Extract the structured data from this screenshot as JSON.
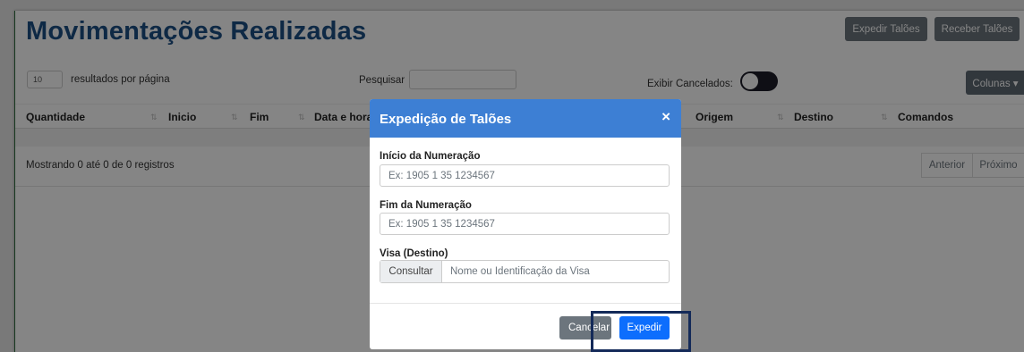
{
  "page": {
    "title": "Movimentações Realizadas",
    "buttons": {
      "expedir": "Expedir Talões",
      "receber": "Receber Talões"
    },
    "page_length": "10",
    "page_length_label": "resultados por página",
    "search_label": "Pesquisar",
    "search_value": "",
    "show_cancelled_label": "Exibir Cancelados:",
    "columns_button": "Colunas ▾",
    "table": {
      "headers": [
        "Quantidade",
        "Inicio",
        "Fim",
        "Data e hora",
        "Origem",
        "Destino",
        "Comandos"
      ],
      "rows": []
    },
    "info": "Mostrando 0 até 0 de 0 registros",
    "pager": {
      "previous": "Anterior",
      "next": "Próximo"
    }
  },
  "modal": {
    "title": "Expedição de Talões",
    "close": "×",
    "fields": [
      {
        "label": "Início da Numeração",
        "placeholder": "Ex: 1905 1 35 1234567"
      },
      {
        "label": "Fim da Numeração",
        "placeholder": "Ex: 1905 1 35 1234567"
      },
      {
        "label": "Visa (Destino)",
        "button": "Consultar",
        "placeholder": "Nome ou Identificação da Visa"
      }
    ],
    "cancel_label": "Cancelar",
    "submit_label": "Expedir"
  },
  "colors": {
    "title": "#1c4f85",
    "modal_header": "#3d7fd4",
    "primary": "#0d6efd",
    "secondary": "#6c757d",
    "highlight": "#142a59"
  }
}
